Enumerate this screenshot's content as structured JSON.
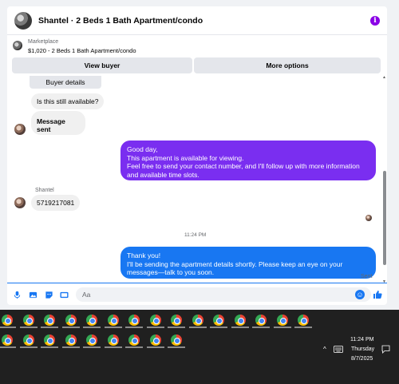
{
  "header": {
    "title": "Shantel · 2 Beds 1 Bath Apartment/condo",
    "info_glyph": "i"
  },
  "listing": {
    "label": "Marketplace",
    "title": "$1,020 - 2 Beds 1 Bath Apartment/condo"
  },
  "actions": {
    "view_buyer": "View buyer",
    "more_options": "More options"
  },
  "messages": {
    "buyer_details_button": "Buyer details",
    "still_available": "Is this still available?",
    "message_sent": "Message sent",
    "seller_reply_lines": [
      "Good day,",
      "This apartment is available for viewing.",
      "Feel free to send your contact number, and I'll follow up with more information and available time slots."
    ],
    "buyer_name": "Shantel",
    "buyer_phone": "5719217081",
    "timestamp": "11:24 PM",
    "final_reply_lines": [
      "Thank you!",
      "I'll be sending the apartment details shortly. Please keep an eye on your messages—talk to you soon."
    ],
    "status": "Sent"
  },
  "composer": {
    "placeholder": "Aa"
  },
  "colors": {
    "purple_bubble": "#7a2ef0",
    "blue_bubble": "#1877f2",
    "accent": "#1877f2"
  },
  "taskbar": {
    "row1_count": 15,
    "row2_count": 9,
    "icon": "chrome-icon",
    "keyboard_icon": "keyboard-icon",
    "time": "11:24 PM",
    "day": "Thursday",
    "date": "8/7/2025"
  }
}
